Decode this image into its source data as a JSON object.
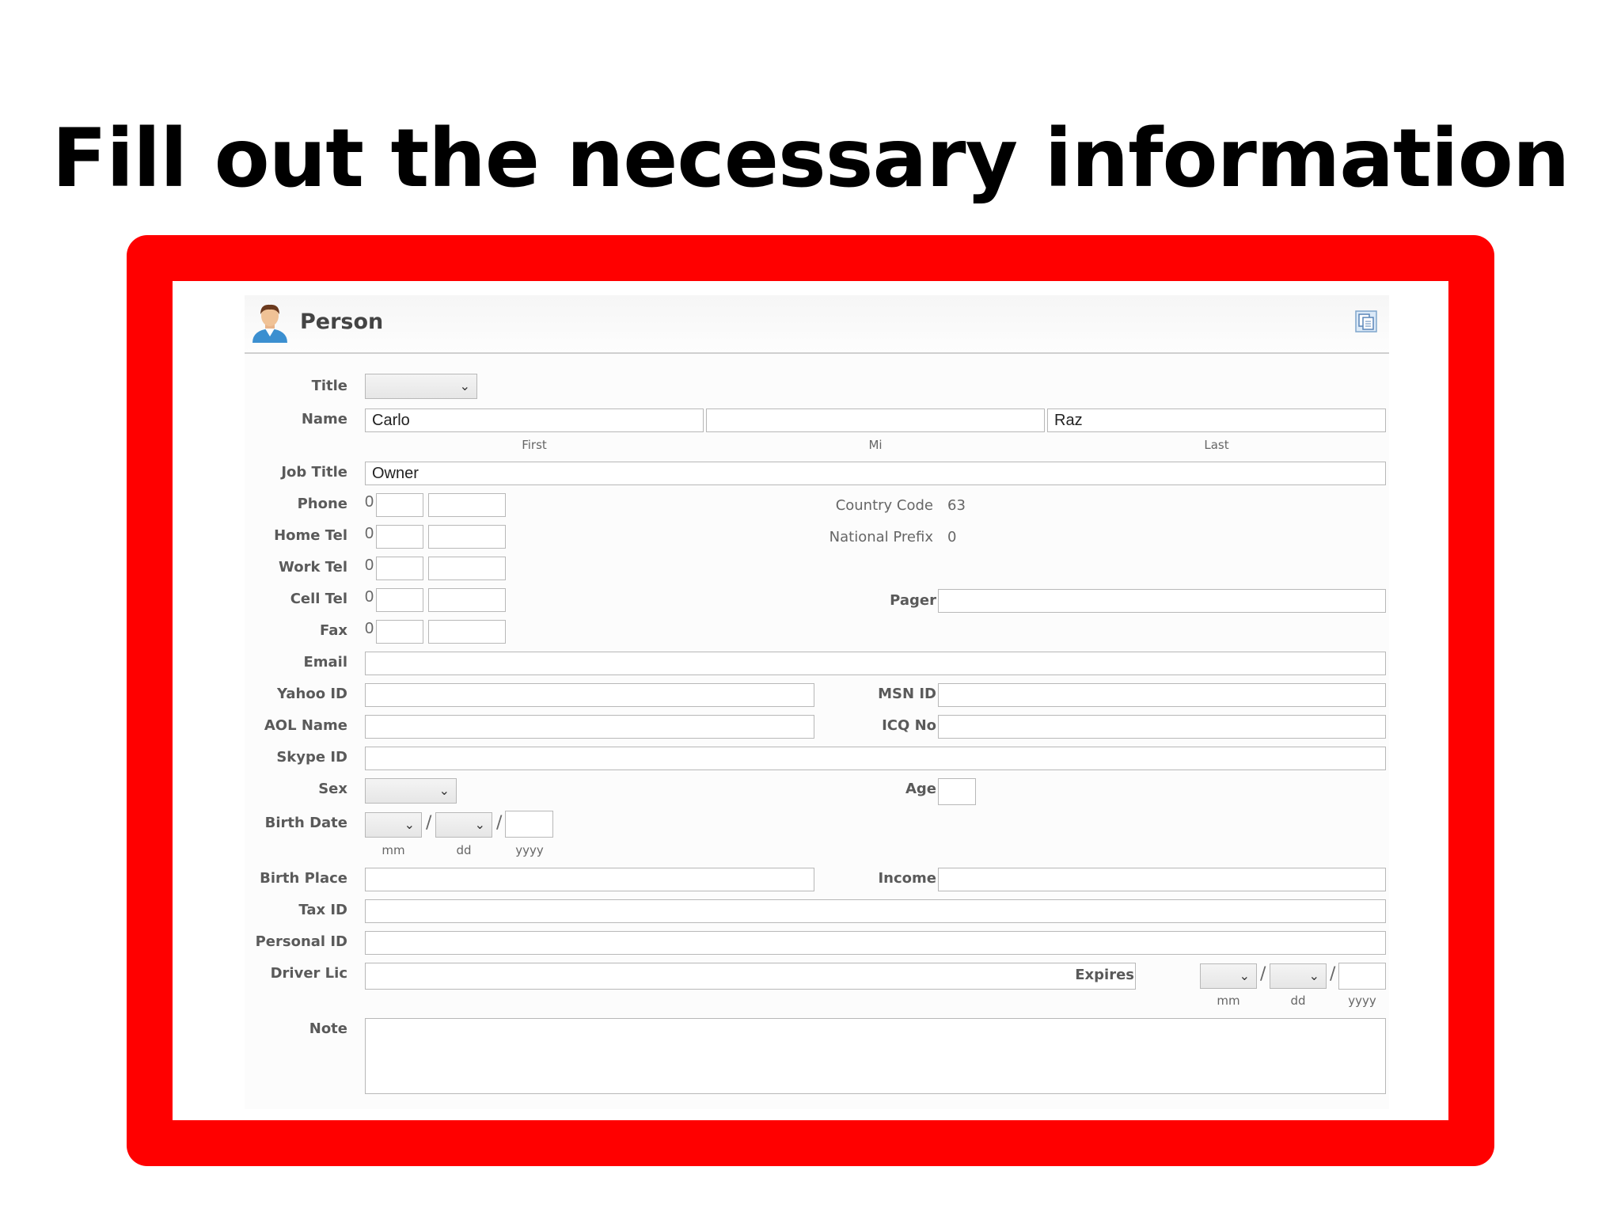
{
  "slide": {
    "title": "Fill out the necessary information"
  },
  "panel": {
    "title": "Person"
  },
  "labels": {
    "title": "Title",
    "name": "Name",
    "job_title": "Job Title",
    "phone": "Phone",
    "home_tel": "Home Tel",
    "work_tel": "Work Tel",
    "cell_tel": "Cell Tel",
    "fax": "Fax",
    "email": "Email",
    "yahoo_id": "Yahoo ID",
    "msn_id": "MSN ID",
    "aol_name": "AOL Name",
    "icq_no": "ICQ No",
    "skype_id": "Skype ID",
    "sex": "Sex",
    "age": "Age",
    "birth_date": "Birth Date",
    "birth_place": "Birth Place",
    "income": "Income",
    "tax_id": "Tax ID",
    "personal_id": "Personal ID",
    "driver_lic": "Driver Lic",
    "expires": "Expires",
    "note": "Note",
    "pager": "Pager",
    "country_code": "Country Code",
    "national_prefix": "National Prefix"
  },
  "sublabels": {
    "first": "First",
    "mi": "Mi",
    "last": "Last",
    "mm": "mm",
    "dd": "dd",
    "yyyy": "yyyy"
  },
  "values": {
    "first_name": "Carlo",
    "middle_initial": "",
    "last_name": "Raz",
    "job_title": "Owner",
    "country_code": "63",
    "national_prefix": "0",
    "phone_prefix": "0",
    "slash": "/"
  },
  "icons": {
    "person": "person-avatar-icon",
    "copy": "copy-icon",
    "dropdown": "chevron-down-icon"
  },
  "colors": {
    "frame": "#ff0000",
    "panel_bg": "#fcfcfc",
    "border": "#b8b8b8"
  }
}
